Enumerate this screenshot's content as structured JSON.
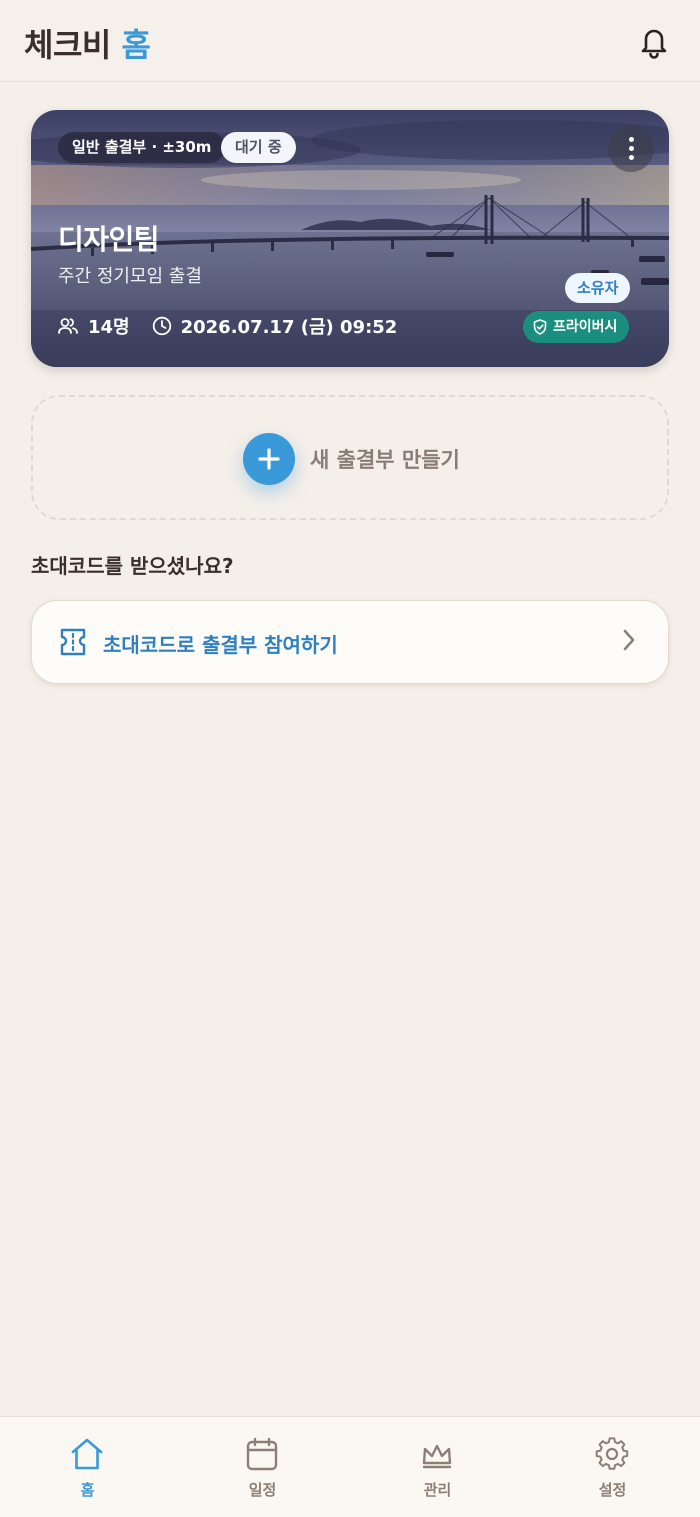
{
  "header": {
    "title_main": "체크비",
    "title_accent": "홈",
    "notification_icon": "bell-icon"
  },
  "attendance_card": {
    "type_pill": "일반 출결부 · ±30m",
    "status_pill": "대기 중",
    "title": "디자인팀",
    "subtitle": "주간 정기모임 출결",
    "owner_badge": "소유자",
    "members": "14명",
    "datetime": "2026.07.17 (금) 09:52",
    "privacy_badge": "프라이버시",
    "more_icon": "more-vertical-icon",
    "privacy_color": "#1a8e7f"
  },
  "create": {
    "label": "새 출결부 만들기",
    "icon": "plus-icon"
  },
  "invite": {
    "section_title": "초대코드를 받으셨나요?",
    "button_label": "초대코드로 출결부 참여하기",
    "icon": "ticket-icon"
  },
  "nav": {
    "items": [
      {
        "label": "홈",
        "icon": "home-icon",
        "active": true
      },
      {
        "label": "일정",
        "icon": "calendar-icon",
        "active": false
      },
      {
        "label": "관리",
        "icon": "crown-icon",
        "active": false
      },
      {
        "label": "설정",
        "icon": "gear-icon",
        "active": false
      }
    ]
  },
  "colors": {
    "accent": "#3a9ad9",
    "background": "#f5efe9",
    "text_dark": "#3b2f2a"
  }
}
